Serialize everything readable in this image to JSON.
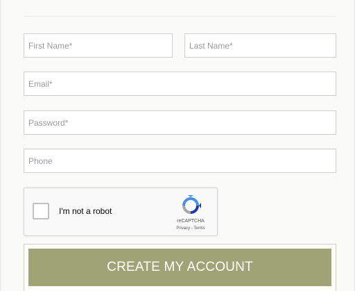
{
  "form": {
    "first_name_placeholder": "First Name*",
    "last_name_placeholder": "Last Name*",
    "email_placeholder": "Email*",
    "password_placeholder": "Password*",
    "phone_placeholder": "Phone"
  },
  "captcha": {
    "label": "I'm not a robot",
    "brand": "reCAPTCHA",
    "links": "Privacy - Terms",
    "checked": false,
    "icon": "recaptcha-logo-icon"
  },
  "submit": {
    "label": "CREATE MY ACCOUNT"
  },
  "colors": {
    "button_bg": "#a0a375",
    "button_text": "#ffffff",
    "field_border": "#cfcfcf",
    "placeholder": "#9a9a9a"
  }
}
